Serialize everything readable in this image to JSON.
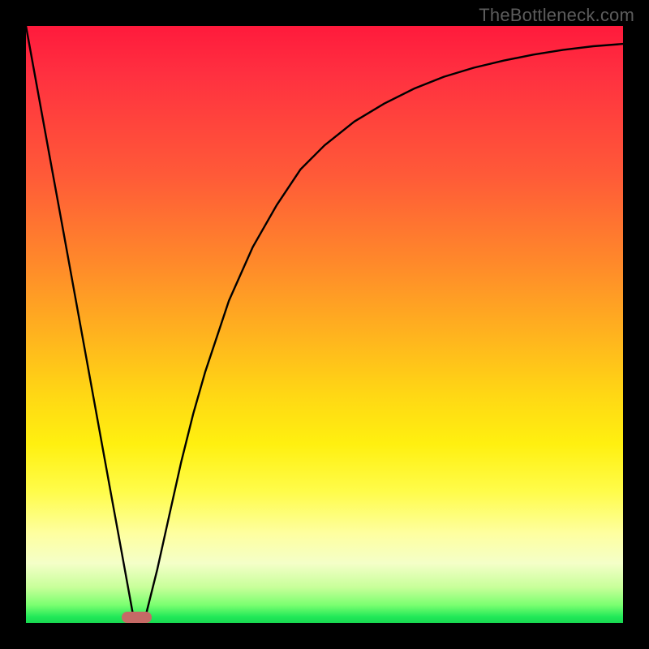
{
  "attribution": "TheBottleneck.com",
  "colors": {
    "frame": "#000000",
    "attribution_text": "#5c5c5c",
    "curve": "#000000",
    "marker": "#c66a66",
    "gradient_stops": [
      "#ff1a3c",
      "#ff3040",
      "#ff5a38",
      "#ff8a2a",
      "#ffb41e",
      "#ffd814",
      "#fff010",
      "#fffc4a",
      "#feffa0",
      "#f4ffc8",
      "#c8ff9a",
      "#7aff70",
      "#20e858",
      "#18d850"
    ]
  },
  "chart_data": {
    "type": "line",
    "title": "",
    "xlabel": "",
    "ylabel": "",
    "xlim": [
      0,
      100
    ],
    "ylim": [
      0,
      100
    ],
    "grid": false,
    "legend": false,
    "annotations": [
      "TheBottleneck.com"
    ],
    "marker": {
      "x_center": 18.5,
      "width": 5,
      "color": "#c66a66"
    },
    "series": [
      {
        "name": "bottleneck-curve",
        "x": [
          0,
          2,
          4,
          6,
          8,
          10,
          12,
          14,
          16,
          18,
          20,
          22,
          24,
          26,
          28,
          30,
          34,
          38,
          42,
          46,
          50,
          55,
          60,
          65,
          70,
          75,
          80,
          85,
          90,
          95,
          100
        ],
        "y": [
          100,
          89,
          78,
          67,
          56,
          45,
          34,
          23,
          12,
          1,
          1,
          9,
          18,
          27,
          35,
          42,
          54,
          63,
          70,
          76,
          80,
          84,
          87,
          89.5,
          91.5,
          93,
          94.2,
          95.2,
          96,
          96.6,
          97
        ]
      }
    ]
  }
}
